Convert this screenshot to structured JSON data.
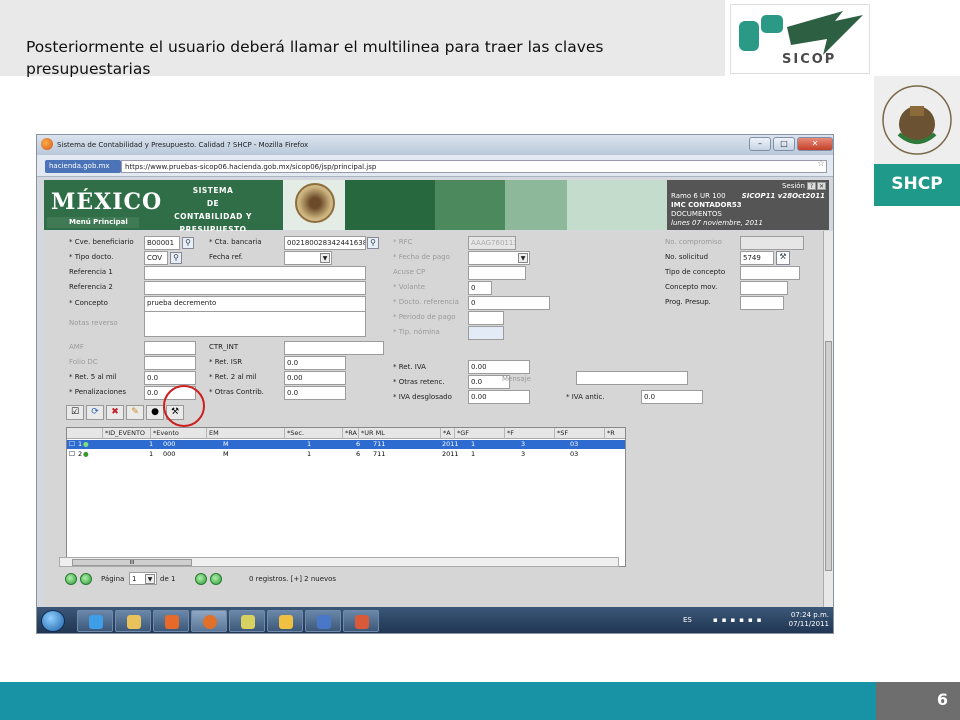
{
  "slide": {
    "title": "Posteriormente  el usuario deberá  llamar  el multilinea para traer  las  claves presupuestarias",
    "sicop_label": "SICOP",
    "shcp_label": "SHCP",
    "page_number": "6"
  },
  "browser": {
    "window_title": "Sistema de Contabilidad y Presupuesto. Calidad ? SHCP - Mozilla Firefox",
    "site_tag": "hacienda.gob.mx",
    "url": "https://www.pruebas-sicop06.hacienda.gob.mx/sicop06/jsp/principal.jsp",
    "min": "–",
    "max": "□",
    "close": "✕"
  },
  "app": {
    "logo_text": "MÉXICO",
    "menu_principal": "Menú Principal",
    "system_line1": "SISTEMA",
    "system_line2": "DE",
    "system_line3": "CONTABILIDAD Y PRESUPUESTO",
    "session": "Sesión",
    "ramo": "Ramo  6  UR 100",
    "version": "SICOP11  v28Oct2011",
    "user": "IMC CONTADOR53",
    "module": "DOCUMENTOS",
    "date": "lunes 07 noviembre, 2011",
    "help_btn": "?",
    "close_btn": "✕"
  },
  "form": {
    "cve_beneficiario_label": "* Cve. beneficiario",
    "cve_beneficiario_value": "B00001",
    "cta_bancaria_label": "* Cta. bancaria",
    "cta_bancaria_value": "002180028342441638",
    "rfc_label": "* RFC",
    "rfc_value": "AAAG760113",
    "no_compromiso_label": "No. compromiso",
    "tipo_docto_label": "* Tipo docto.",
    "tipo_docto_value": "COV",
    "fecha_ref_label": "Fecha ref.",
    "fecha_pago_label": "* Fecha de pago",
    "no_solicitud_label": "No. solicitud",
    "no_solicitud_value": "5749",
    "referencia1_label": "Referencia 1",
    "acuse_cp_label": "Acuse CP",
    "tipo_concepto_label": "Tipo de concepto",
    "referencia2_label": "Referencia 2",
    "volante_label": "* Volante",
    "volante_value": "0",
    "concepto_mov_label": "Concepto mov.",
    "concepto_label": "* Concepto",
    "concepto_value": "prueba  decremento",
    "docto_ref_label": "* Docto. referencia",
    "docto_ref_value": "0",
    "prog_presup_label": "Prog. Presup.",
    "periodo_pago_label": "* Periodo de pago",
    "notas_reverso_label": "Notas reverso",
    "tip_nomina_label": "* Tip. nómina",
    "amf_label": "AMF",
    "ctr_int_label": "CTR_INT",
    "folio_dc_label": "Folio DC",
    "ret_isr_label": "* Ret. ISR",
    "ret_isr_value": "0.0",
    "ret_iva_label": "* Ret. IVA",
    "ret_iva_value": "0.00",
    "ret5_label": "* Ret. 5 al mil",
    "ret5_value": "0.0",
    "ret2_label": "* Ret. 2 al mil",
    "ret2_value": "0.00",
    "otras_retenc_label": "* Otras retenc.",
    "otras_retenc_value": "0.0",
    "mensaje_label": "Mensaje",
    "penalizaciones_label": "* Penalizaciones",
    "penalizaciones_value": "0.0",
    "otras_contrib_label": "* Otras Contrib.",
    "otras_contrib_value": "0.0",
    "iva_desglosado_label": "* IVA desglosado",
    "iva_desglosado_value": "0.00",
    "iva_antic_label": "* IVA antic.",
    "iva_antic_value": "0.0"
  },
  "grid": {
    "columns": [
      "*ID_EVENTO",
      "*Evento",
      "EM",
      "*Sec.",
      "*RA",
      "*UR ML",
      "*A",
      "*GF",
      "*F",
      "*SF",
      "*R"
    ],
    "rows": [
      {
        "num": "1",
        "id_evento": "1",
        "evento": "000",
        "em": "M",
        "sec": "1",
        "ra": "6",
        "ur_ml": "711",
        "a": "2011",
        "gf": "1",
        "f": "3",
        "sf": "03"
      },
      {
        "num": "2",
        "id_evento": "1",
        "evento": "000",
        "em": "M",
        "sec": "1",
        "ra": "6",
        "ur_ml": "711",
        "a": "2011",
        "gf": "1",
        "f": "3",
        "sf": "03"
      }
    ],
    "scroll_grip": "III"
  },
  "pager": {
    "page_label": "Página",
    "page_value": "1",
    "of_label": "de 1",
    "status": "0 registros.  [+] 2 nuevos"
  },
  "taskbar": {
    "lang": "ES",
    "time": "07:24 p.m.",
    "date": "07/11/2011"
  },
  "colors": {
    "header_green": "#2f6e47",
    "teal_band": "#1893a6",
    "shcp_teal": "#1f9a8a",
    "selected_row": "#2d6bd0",
    "highlight_circle": "#cc1f1f"
  }
}
